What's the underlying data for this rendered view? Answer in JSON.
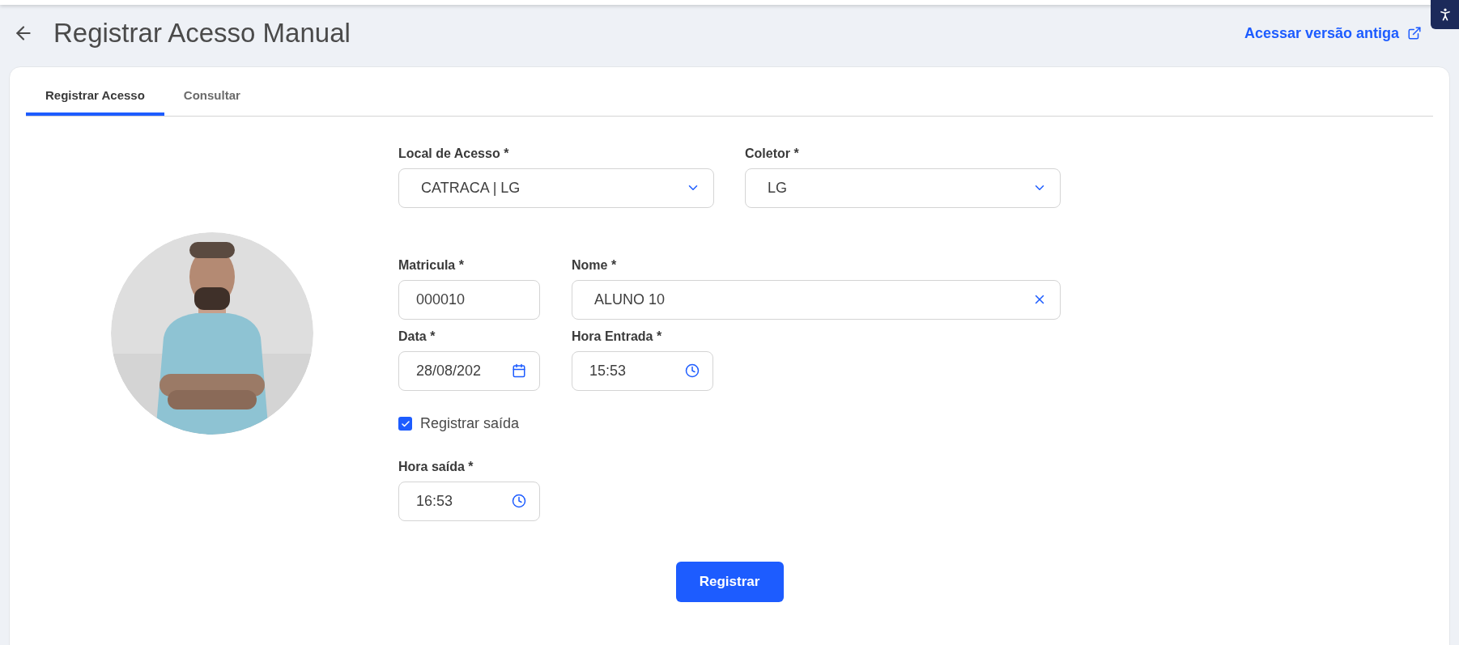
{
  "header": {
    "title": "Registrar Acesso Manual",
    "link": "Acessar versão antiga"
  },
  "tabs": [
    {
      "label": "Registrar Acesso",
      "selected": true
    },
    {
      "label": "Consultar",
      "selected": false
    }
  ],
  "rows": [
    [
      {
        "label": "Local de Acesso *",
        "value": "CATRACA | LG",
        "kind": "select"
      },
      {
        "label": "Coletor *",
        "value": "LG",
        "kind": "select"
      }
    ],
    [
      {
        "label": "Matricula *",
        "value": "000010",
        "kind": "text"
      },
      {
        "label": "Nome *",
        "value": "ALUNO 10",
        "kind": "clearable"
      }
    ],
    [
      {
        "label": "Data *",
        "value": "28/08/202",
        "kind": "date"
      },
      {
        "label": "Hora Entrada *",
        "value": "15:53",
        "kind": "time"
      }
    ]
  ],
  "registrar_saida": {
    "label": "Registrar saída",
    "checked": true
  },
  "hora_saida": {
    "label": "Hora saída *",
    "value": "16:53",
    "kind": "time"
  },
  "submit": "Registrar"
}
